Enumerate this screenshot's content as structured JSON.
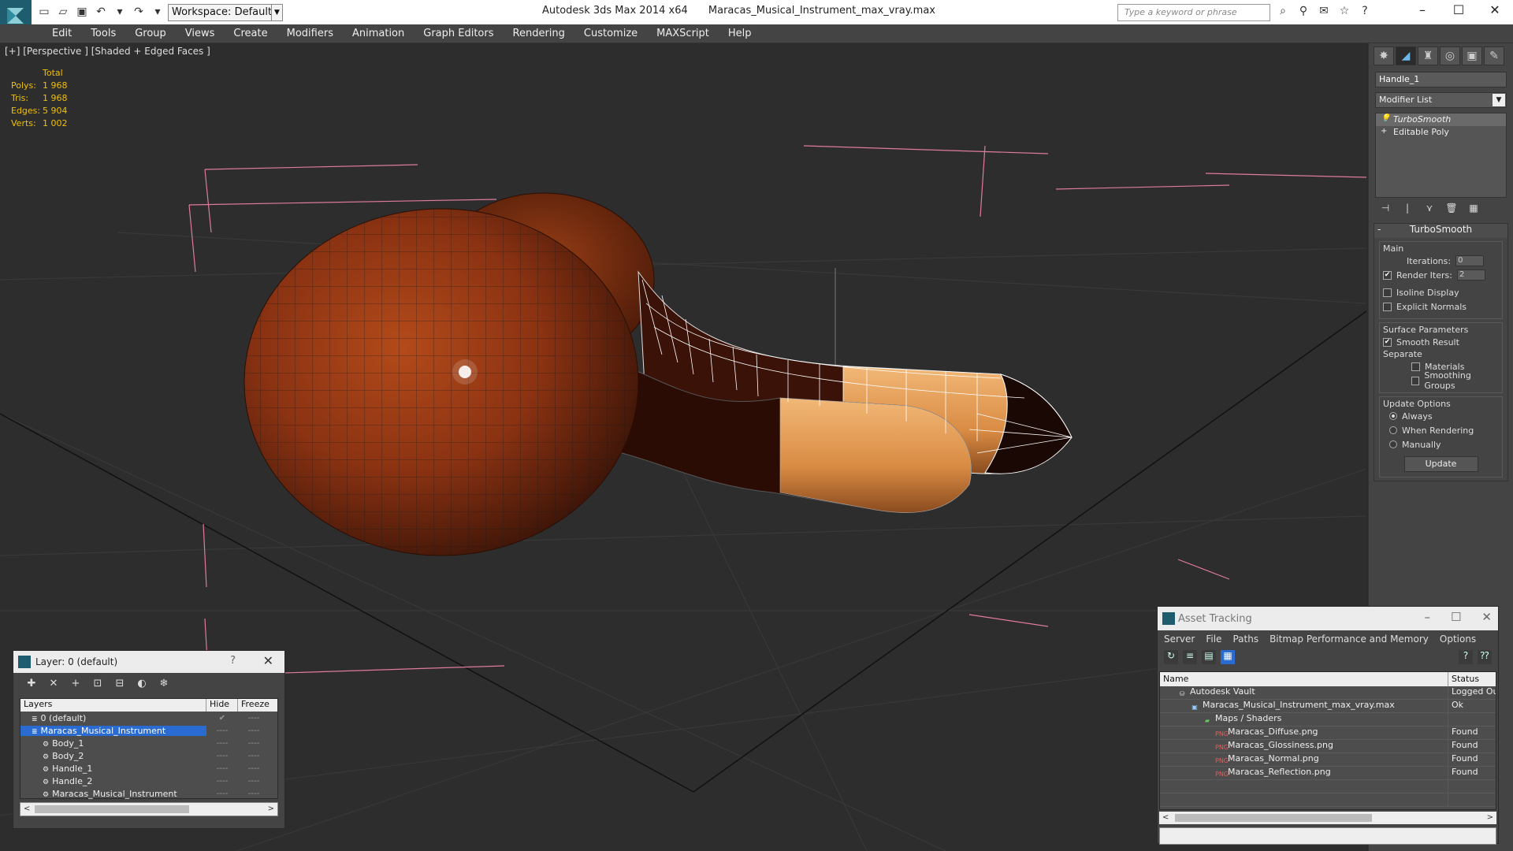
{
  "titlebar": {
    "app": "Autodesk 3ds Max  2014 x64",
    "file": "Maracas_Musical_Instrument_max_vray.max",
    "workspace": "Workspace: Default",
    "search_placeholder": "Type a keyword or phrase"
  },
  "menu": [
    "Edit",
    "Tools",
    "Group",
    "Views",
    "Create",
    "Modifiers",
    "Animation",
    "Graph Editors",
    "Rendering",
    "Customize",
    "MAXScript",
    "Help"
  ],
  "viewport": {
    "label": "[+] [Perspective ] [Shaded + Edged Faces ]",
    "stats": {
      "header": "Total",
      "rows": [
        {
          "k": "Polys:",
          "v": "1 968"
        },
        {
          "k": "Tris:",
          "v": "1 968"
        },
        {
          "k": "Edges:",
          "v": "5 904"
        },
        {
          "k": "Verts:",
          "v": "1 002"
        }
      ]
    }
  },
  "command_panel": {
    "object_name": "Handle_1",
    "modifier_list": "Modifier List",
    "stack": [
      "TurboSmooth",
      "Editable Poly"
    ],
    "rollout": "TurboSmooth",
    "main_label": "Main",
    "iterations_label": "Iterations:",
    "iterations_value": "0",
    "render_iters_label": "Render Iters:",
    "render_iters_value": "2",
    "isoline": "Isoline Display",
    "explicit": "Explicit Normals",
    "surface_label": "Surface Parameters",
    "smooth_result": "Smooth Result",
    "separate_label": "Separate",
    "materials": "Materials",
    "smoothing_groups": "Smoothing Groups",
    "update_options": "Update Options",
    "always": "Always",
    "when_rendering": "When Rendering",
    "manually": "Manually",
    "update_btn": "Update"
  },
  "layer_window": {
    "title": "Layer: 0 (default)",
    "col_layers": "Layers",
    "col_hide": "Hide",
    "col_freeze": "Freeze",
    "rows": [
      {
        "name": "0 (default)",
        "indent": 1,
        "hide": "✔"
      },
      {
        "name": "Maracas_Musical_Instrument",
        "indent": 1,
        "hide": "----",
        "selected": true
      },
      {
        "name": "Body_1",
        "indent": 2,
        "hide": "----"
      },
      {
        "name": "Body_2",
        "indent": 2,
        "hide": "----"
      },
      {
        "name": "Handle_1",
        "indent": 2,
        "hide": "----"
      },
      {
        "name": "Handle_2",
        "indent": 2,
        "hide": "----"
      },
      {
        "name": "Maracas_Musical_Instrument",
        "indent": 2,
        "hide": "----"
      }
    ]
  },
  "asset_window": {
    "title": "Asset Tracking",
    "menu": [
      "Server",
      "File",
      "Paths",
      "Bitmap Performance and Memory",
      "Options"
    ],
    "col_name": "Name",
    "col_status": "Status",
    "rows": [
      {
        "name": "Autodesk Vault",
        "status": "Logged Out",
        "indent": 1
      },
      {
        "name": "Maracas_Musical_Instrument_max_vray.max",
        "status": "Ok",
        "indent": 2
      },
      {
        "name": "Maps / Shaders",
        "status": "",
        "indent": 3
      },
      {
        "name": "Maracas_Diffuse.png",
        "status": "Found",
        "indent": 4
      },
      {
        "name": "Maracas_Glossiness.png",
        "status": "Found",
        "indent": 4
      },
      {
        "name": "Maracas_Normal.png",
        "status": "Found",
        "indent": 4
      },
      {
        "name": "Maracas_Reflection.png",
        "status": "Found",
        "indent": 4
      }
    ]
  }
}
